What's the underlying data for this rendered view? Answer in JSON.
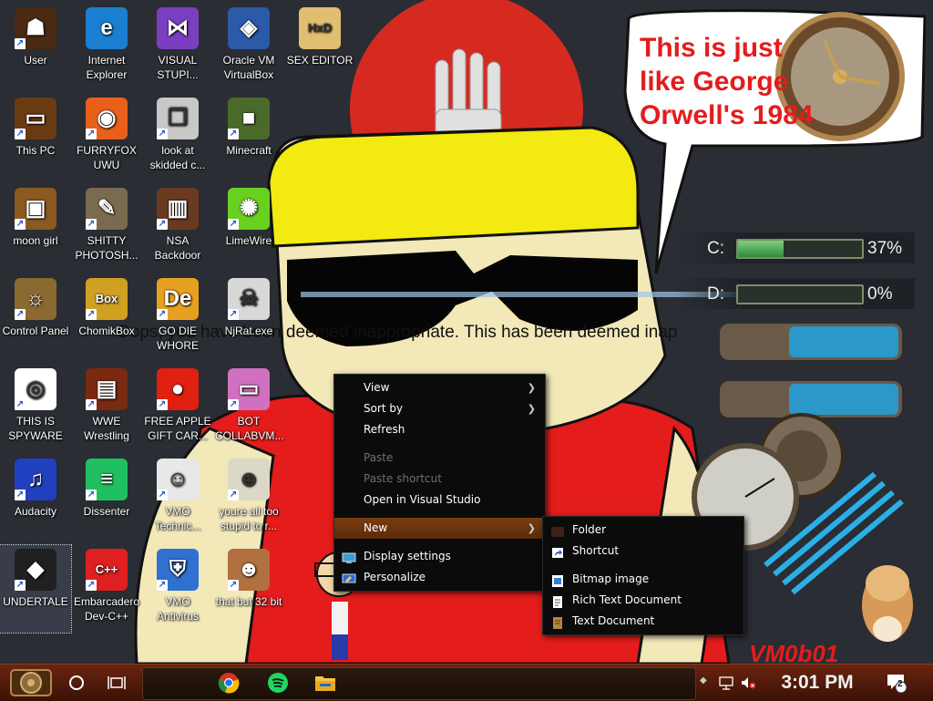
{
  "desktop_icons": [
    {
      "label": "User",
      "icon": "user-icon",
      "col": 0,
      "row": 0,
      "color": "#4a2a12",
      "glyph": "☗"
    },
    {
      "label": "Internet Explorer",
      "icon": "edge-icon",
      "col": 1,
      "row": 0,
      "color": "#1a7fd0",
      "glyph": "e"
    },
    {
      "label": "VISUAL STUPI...",
      "icon": "visual-studio-icon",
      "col": 2,
      "row": 0,
      "color": "#7a3fc0",
      "glyph": "⋈"
    },
    {
      "label": "Oracle VM VirtualBox",
      "icon": "virtualbox-icon",
      "col": 3,
      "row": 0,
      "color": "#2a5aa8",
      "glyph": "◈"
    },
    {
      "label": "SEX EDITOR",
      "icon": "hex-editor-icon",
      "col": 4,
      "row": 0,
      "color": "#e0c070",
      "glyph": "HxD"
    },
    {
      "label": "This PC",
      "icon": "this-pc-icon",
      "col": 0,
      "row": 1,
      "color": "#6a3a12",
      "glyph": "▭"
    },
    {
      "label": "FURRYFOX UWU",
      "icon": "firefox-icon",
      "col": 1,
      "row": 1,
      "color": "#e8601a",
      "glyph": "◉"
    },
    {
      "label": "look at skidded c...",
      "icon": "window-stack-icon",
      "col": 2,
      "row": 1,
      "color": "#c8c8c8",
      "glyph": "❐"
    },
    {
      "label": "Minecraft",
      "icon": "minecraft-icon",
      "col": 3,
      "row": 1,
      "color": "#4a6a2a",
      "glyph": "■"
    },
    {
      "label": "moon girl",
      "icon": "moon-girl-icon",
      "col": 0,
      "row": 2,
      "color": "#8a5a20",
      "glyph": "▣"
    },
    {
      "label": "SHITTY PHOTOSH...",
      "icon": "gimp-icon",
      "col": 1,
      "row": 2,
      "color": "#7a6a50",
      "glyph": "✎"
    },
    {
      "label": "NSA Backdoor",
      "icon": "nsa-backdoor-icon",
      "col": 2,
      "row": 2,
      "color": "#6a3a20",
      "glyph": "▥"
    },
    {
      "label": "LimeWire",
      "icon": "limewire-icon",
      "col": 3,
      "row": 2,
      "color": "#6ad020",
      "glyph": "✺"
    },
    {
      "label": "Control Panel",
      "icon": "control-panel-icon",
      "col": 0,
      "row": 3,
      "color": "#8a6a30",
      "glyph": "☼"
    },
    {
      "label": "ChomikBox",
      "icon": "chomikbox-icon",
      "col": 1,
      "row": 3,
      "color": "#d0a020",
      "glyph": "Box"
    },
    {
      "label": "GO DIE WHORE",
      "icon": "de-icon",
      "col": 2,
      "row": 3,
      "color": "#e8a020",
      "glyph": "De"
    },
    {
      "label": "NjRat.exe",
      "icon": "skull-icon",
      "col": 3,
      "row": 3,
      "color": "#d8d8d8",
      "glyph": "☠"
    },
    {
      "label": "THIS IS SPYWARE",
      "icon": "chrome-icon",
      "col": 0,
      "row": 4,
      "color": "#ffffff",
      "glyph": "◎"
    },
    {
      "label": "WWE Wrestling",
      "icon": "wwe-icon",
      "col": 1,
      "row": 4,
      "color": "#7a2a10",
      "glyph": "▤"
    },
    {
      "label": "FREE APPLE GIFT CAR...",
      "icon": "apple-icon",
      "col": 2,
      "row": 4,
      "color": "#e02010",
      "glyph": "●"
    },
    {
      "label": "BOT COLLABVM...",
      "icon": "monitor-icon",
      "col": 3,
      "row": 4,
      "color": "#d070c0",
      "glyph": "▭"
    },
    {
      "label": "Audacity",
      "icon": "audacity-icon",
      "col": 0,
      "row": 5,
      "color": "#2040c0",
      "glyph": "♫"
    },
    {
      "label": "Dissenter",
      "icon": "spotify-icon",
      "col": 1,
      "row": 5,
      "color": "#20c060",
      "glyph": "≡"
    },
    {
      "label": "VMO Technic...",
      "icon": "doctor-icon",
      "col": 2,
      "row": 5,
      "color": "#e8e8e8",
      "glyph": "☺"
    },
    {
      "label": "youre all too stupid to r...",
      "icon": "portrait-icon",
      "col": 3,
      "row": 5,
      "color": "#dcd8c8",
      "glyph": "☻"
    },
    {
      "label": "UNDERTALE",
      "icon": "unity-icon",
      "col": 0,
      "row": 6,
      "color": "#202020",
      "glyph": "◆",
      "selected": true
    },
    {
      "label": "Embarcadero Dev-C++",
      "icon": "devcpp-icon",
      "col": 1,
      "row": 6,
      "color": "#e02020",
      "glyph": "C++"
    },
    {
      "label": "VMO Antivirus",
      "icon": "shield-icon",
      "col": 2,
      "row": 6,
      "color": "#3070d0",
      "glyph": "⛨"
    },
    {
      "label": "that but 32 bit",
      "icon": "portrait-32bit-icon",
      "col": 3,
      "row": 6,
      "color": "#b07040",
      "glyph": "☻"
    }
  ],
  "wallpaper": {
    "speech_text": "This is just like George Orwell's 1984",
    "banner_text": "Oops, you have been deemed inappropriate. This has been deemed inap",
    "signature": "VM0b01"
  },
  "context_menu": {
    "items": [
      {
        "label": "View",
        "submenu": true
      },
      {
        "label": "Sort by",
        "submenu": true
      },
      {
        "label": "Refresh"
      },
      {
        "sep": true
      },
      {
        "label": "Paste",
        "disabled": true
      },
      {
        "label": "Paste shortcut",
        "disabled": true
      },
      {
        "label": "Open in Visual Studio"
      },
      {
        "sep": true
      },
      {
        "label": "New",
        "submenu": true,
        "highlight": true
      },
      {
        "sep": true
      },
      {
        "label": "Display settings",
        "icon": "display-settings-icon"
      },
      {
        "label": "Personalize",
        "icon": "personalize-icon"
      }
    ]
  },
  "new_submenu": {
    "items": [
      {
        "label": "Folder",
        "icon": "folder-icon"
      },
      {
        "label": "Shortcut",
        "icon": "shortcut-icon"
      },
      {
        "sep": true
      },
      {
        "label": "Bitmap image",
        "icon": "bitmap-icon"
      },
      {
        "label": "Rich Text Document",
        "icon": "rtf-icon"
      },
      {
        "label": "Text Document",
        "icon": "text-doc-icon"
      }
    ]
  },
  "drives": [
    {
      "letter": "C:",
      "percent": 37,
      "percent_label": "37%"
    },
    {
      "letter": "D:",
      "percent": 0,
      "percent_label": "0%"
    }
  ],
  "taskbar": {
    "time": "3:01 PM",
    "notification_count": "2",
    "pinned": [
      "chrome-icon",
      "spotify-icon",
      "file-explorer-icon"
    ]
  },
  "colors": {
    "menu_bg": "#0b0b0b",
    "highlight": "#7a3d10",
    "taskbar": "#5a1e0a",
    "clock_text": "#f0f0f0"
  }
}
